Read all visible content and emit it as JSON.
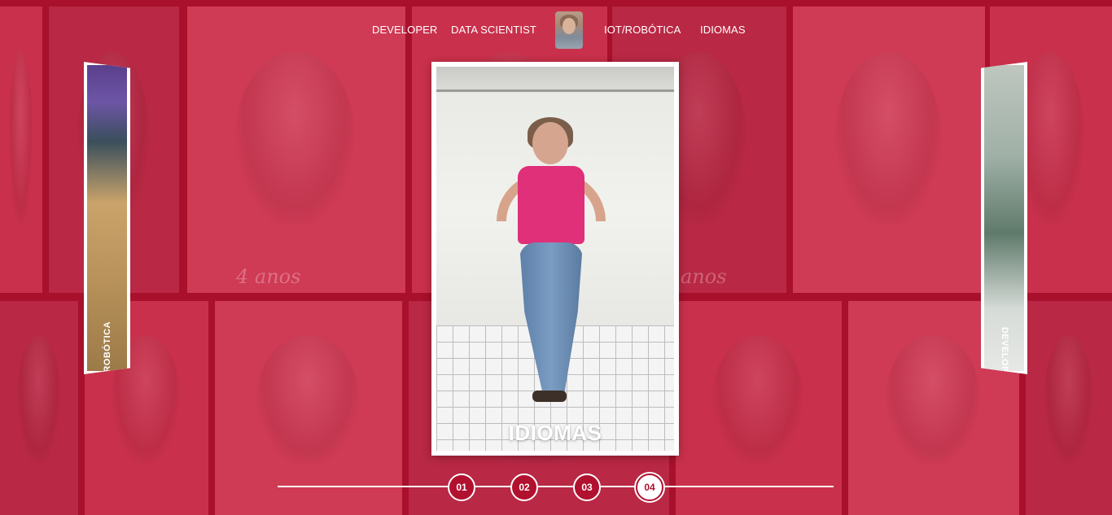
{
  "nav": {
    "items": [
      {
        "label": "DEVELOPER"
      },
      {
        "label": "DATA SCIENTIST"
      },
      {
        "label": "IOT/ROBÓTICA"
      },
      {
        "label": "IDIOMAS"
      }
    ],
    "avatar_icon": "profile-avatar"
  },
  "slider": {
    "active_title": "IDIOMAS",
    "left_card_label": "IOT/ROBÓTICA",
    "right_card_label": "DEVELOPER",
    "pages": [
      "01",
      "02",
      "03",
      "04"
    ],
    "active_page": "04"
  },
  "background": {
    "captions": [
      "4 anos",
      "anos"
    ]
  },
  "colors": {
    "brand_red": "#b2102f",
    "card_border": "#ffffff",
    "accent_pink": "#e0307a"
  }
}
